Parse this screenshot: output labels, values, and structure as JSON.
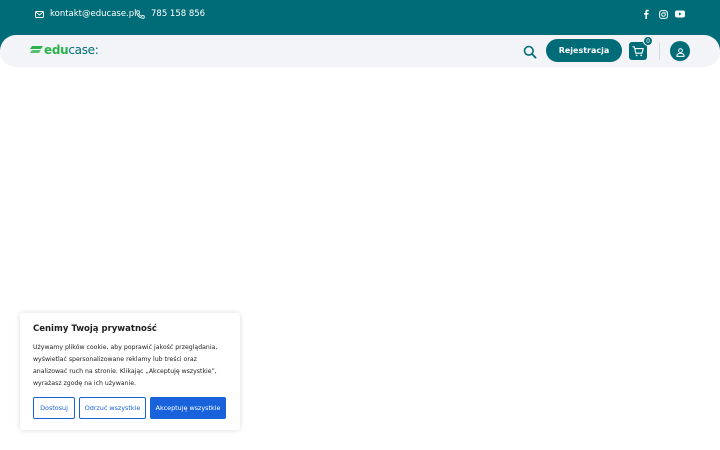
{
  "topbar": {
    "email": "kontakt@educase.pl",
    "phone": "785 158 856",
    "socials": [
      "facebook-icon",
      "instagram-icon",
      "youtube-icon"
    ]
  },
  "header": {
    "logo_part1": "edu",
    "logo_part2": "case",
    "logo_dot": ":",
    "register_label": "Rejestracja",
    "cart_count": "0"
  },
  "cookie_banner": {
    "title": "Cenimy Twoją prywatność",
    "text": "Używamy plików cookie, aby poprawić jakość przeglądania, wyświetlać spersonalizowane reklamy lub treści oraz analizować ruch na stronie. Klikając „Akceptuję wszystkie”, wyrażasz zgodę na ich używanie.",
    "customize_label": "Dostosuj",
    "reject_label": "Odrzuć wszystkie",
    "accept_label": "Akceptuję wszystkie"
  },
  "colors": {
    "brand_teal": "#006c77",
    "brand_green": "#2bb24c",
    "cookie_blue": "#1863dc",
    "navbar_bg": "#f2f4f8"
  }
}
